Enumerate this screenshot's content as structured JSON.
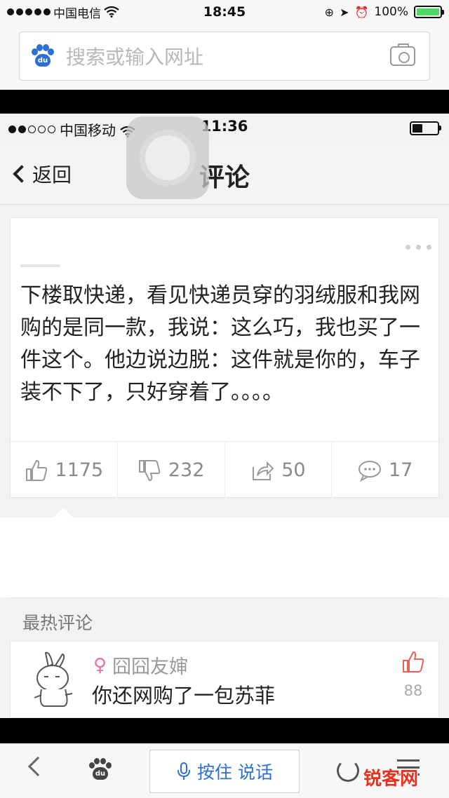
{
  "outer_status": {
    "carrier": "中国电信",
    "time": "18:45",
    "battery": "100%",
    "battery_level": 1.0
  },
  "browser": {
    "search_placeholder": "搜索或输入网址",
    "baidu_icon_text": "du",
    "voice_label": "按住 说话"
  },
  "inner_status": {
    "carrier": "中国移动",
    "time": "11:36",
    "battery_level": 0.4
  },
  "nav": {
    "back_label": "返回",
    "title": "评论"
  },
  "post": {
    "text": "下楼取快递，看见快递员穿的羽绒服和我网购的是同一款，我说：这么巧，我也买了一件这个。他边说边脱：这件就是你的，车子装不下了，只好穿着了。。。。",
    "likes": "1175",
    "dislikes": "232",
    "shares": "50",
    "comments": "17"
  },
  "hot_comments": {
    "heading": "最热评论",
    "items": [
      {
        "gender_icon": "female-icon",
        "author": "囧囧友婶",
        "text": "你还网购了一包苏菲",
        "likes": "88"
      }
    ]
  },
  "watermark": "锐客网",
  "colors": {
    "accent_blue": "#2c6fd6",
    "battery_green": "#4cd964",
    "like_red": "#e8605a",
    "female_pink": "#e66fa8"
  }
}
